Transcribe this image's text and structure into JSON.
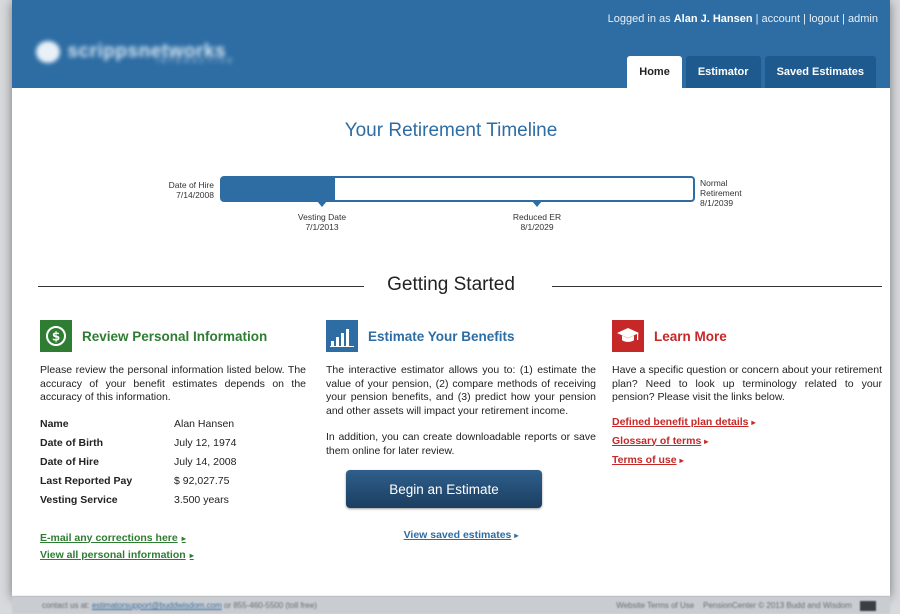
{
  "header": {
    "brand": "scrippsnetworks",
    "brand_sub": "INTERACTIVE",
    "user_prefix": "Logged in as",
    "user_name": "Alan J. Hansen",
    "links": [
      "account",
      "logout",
      "admin"
    ],
    "separator": "|",
    "tabs": [
      {
        "label": "Home",
        "active": true
      },
      {
        "label": "Estimator",
        "active": false
      },
      {
        "label": "Saved Estimates",
        "active": false
      }
    ]
  },
  "timeline": {
    "title": "Your Retirement Timeline",
    "progress_fraction": 0.24,
    "start": {
      "label": "Date of Hire",
      "date": "7/14/2008"
    },
    "end": {
      "label_line1": "Normal",
      "label_line2": "Retirement",
      "date": "8/1/2039"
    },
    "markers": [
      {
        "label": "Vesting Date",
        "date": "7/1/2013"
      },
      {
        "label": "Reduced ER",
        "date": "8/1/2029"
      }
    ]
  },
  "getting_started": {
    "title": "Getting Started"
  },
  "review": {
    "icon": "dollar-icon",
    "title": "Review Personal Information",
    "body": "Please review the personal information listed below. The accuracy of your benefit estimates depends on the accuracy of this information.",
    "rows": [
      {
        "label": "Name",
        "value": "Alan Hansen"
      },
      {
        "label": "Date of Birth",
        "value": "July 12, 1974"
      },
      {
        "label": "Date of Hire",
        "value": "July 14, 2008"
      },
      {
        "label": "Last Reported Pay",
        "value": "$ 92,027.75"
      },
      {
        "label": "Vesting Service",
        "value": "3.500 years"
      }
    ],
    "link_corrections": "E-mail any corrections here",
    "link_all": "View all personal information",
    "arrow": "▸"
  },
  "estimate": {
    "icon": "bar-chart-icon",
    "title": "Estimate Your Benefits",
    "body1": "The interactive estimator allows you to: (1) estimate the value of your pension, (2) compare methods of receiving your pension benefits, and (3) predict how your pension and other assets will impact your retirement income.",
    "body2": "In addition, you can create downloadable reports or save them online for later review.",
    "button": "Begin an Estimate",
    "link_saved": "View saved estimates",
    "arrow": "▸"
  },
  "learn": {
    "icon": "graduation-cap-icon",
    "title": "Learn More",
    "body": "Have a specific question or concern about your retirement plan? Need to look up terminology related to your pension? Please visit the links below.",
    "links": [
      "Defined benefit plan details",
      "Glossary of terms",
      "Terms of use"
    ],
    "arrow": "▸"
  },
  "footer": {
    "contact_prefix": "contact us at:",
    "email": "estimatorsupport@buddwisdom.com",
    "phone": "or 855-460-5500 (toll free)",
    "terms": "Website Terms of Use",
    "copyright": "PensionCenter © 2013 Budd and Wisdom"
  },
  "colors": {
    "brand_blue": "#2d6da4",
    "green": "#2e7d32",
    "red": "#c62828",
    "button_dark": "#1b3e60"
  }
}
